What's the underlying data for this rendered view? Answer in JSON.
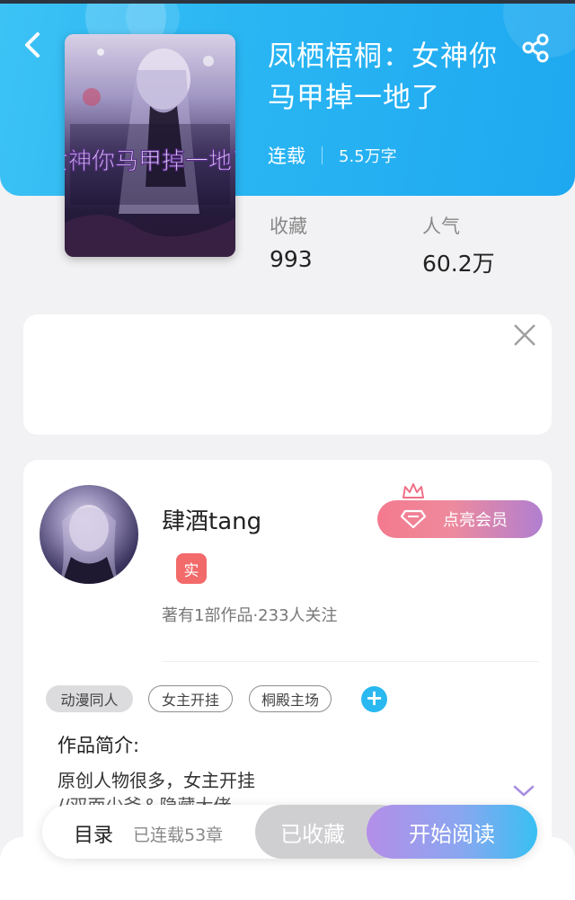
{
  "book": {
    "title": "凤栖梧桐：女神你马甲掉一地了",
    "status": "连载",
    "word_count": "5.5万字",
    "cover_alt": "book-cover",
    "cover_art_text": "女神你马甲掉一地了"
  },
  "stats": {
    "favorites_label": "收藏",
    "favorites_value": "993",
    "popularity_label": "人气",
    "popularity_value": "60.2万"
  },
  "author": {
    "name": "肆酒tang",
    "verified_badge": "实",
    "meta": "著有1部作品·233人关注",
    "vip_button": "点亮会员"
  },
  "tags": [
    "动漫同人",
    "女主开挂",
    "桐殿主场"
  ],
  "intro": {
    "title": "作品简介:",
    "line1": "原创人物很多，女主开挂",
    "line2": "//双面少爷＆隐藏大佬"
  },
  "bottom": {
    "toc_label": "目录",
    "toc_count": "已连载53章",
    "favorite_button": "已收藏",
    "read_button": "开始阅读"
  },
  "colors": {
    "header": "#2ab6f3",
    "accent": "#29b8ef",
    "badge_red": "#f26a6a",
    "fav_grey": "#cfcfd2"
  }
}
